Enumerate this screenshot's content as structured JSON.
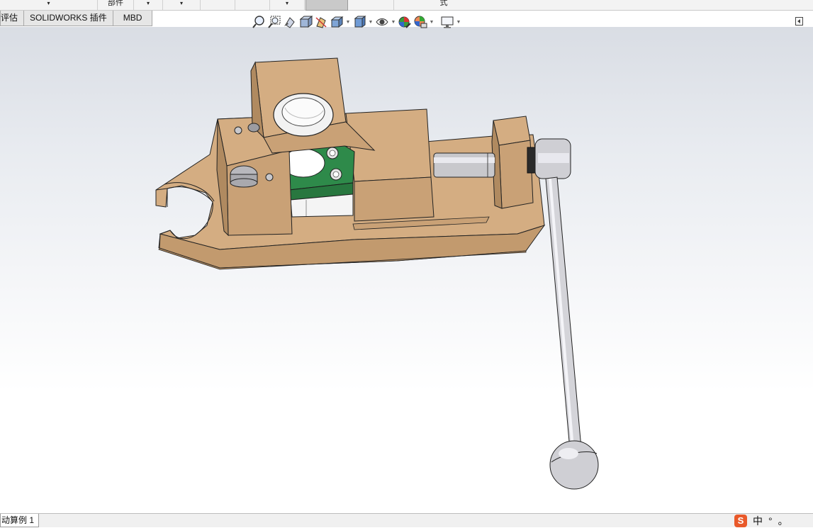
{
  "ribbon": {
    "cells": [
      {
        "label": "▾",
        "active": false
      },
      {
        "label": "▾",
        "active": false
      },
      {
        "label": "部件",
        "active": false
      },
      {
        "label": "▾",
        "active": false
      },
      {
        "label": "▾",
        "active": false
      },
      {
        "label": "",
        "active": false
      },
      {
        "label": "",
        "active": false
      },
      {
        "label": "▾",
        "active": false
      },
      {
        "label": "",
        "active": true
      },
      {
        "label": "",
        "active": false
      },
      {
        "label": "式",
        "active": false
      }
    ]
  },
  "tabs": [
    "评估",
    "SOLIDWORKS 插件",
    "MBD"
  ],
  "hud": {
    "icons": [
      "zoom-to-fit-icon",
      "zoom-to-area-icon",
      "previous-view-icon",
      "section-view-icon",
      "dynamic-annotation-icon",
      "view-orientation-icon",
      "display-style-icon",
      "hide-show-items-icon",
      "edit-appearance-icon",
      "apply-scene-icon",
      "view-settings-icon"
    ]
  },
  "bottom": {
    "tab_label": "动算例 1",
    "ime_logo": "S",
    "ime_lang": "中",
    "ime_punct": "°",
    "ime_mode": "。"
  },
  "colors": {
    "part_tan": "#c9a176",
    "part_tan_light": "#d4ad82",
    "part_tan_dark": "#b08a60",
    "block_green": "#2e8a4a",
    "steel": "#c8c8cc"
  }
}
